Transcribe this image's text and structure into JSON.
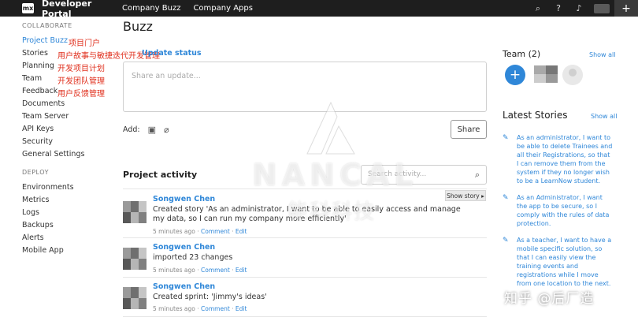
{
  "topbar": {
    "logo": "mx",
    "title": "Developer Portal",
    "nav": [
      "Company Buzz",
      "Company Apps"
    ],
    "icons": [
      "search-icon",
      "help-icon",
      "bell-icon",
      "plus-icon"
    ]
  },
  "sidebar": {
    "collaborate_heading": "COLLABORATE",
    "collaborate_items": [
      "Project Buzz",
      "Stories",
      "Planning",
      "Team",
      "Feedback",
      "Documents",
      "Team Server",
      "API Keys",
      "Security",
      "General Settings"
    ],
    "deploy_heading": "DEPLOY",
    "deploy_items": [
      "Environments",
      "Metrics",
      "Logs",
      "Backups",
      "Alerts",
      "Mobile App"
    ]
  },
  "annotations": [
    "项目门户",
    "用户故事与敏捷迭代开发管理",
    "开发项目计划",
    "开发团队管理",
    "用户反馈管理"
  ],
  "main": {
    "title": "Buzz",
    "update_link": "Update status",
    "update_placeholder": "Share an update...",
    "add_label": "Add:",
    "share_label": "Share",
    "activity_title": "Project activity",
    "search_placeholder": "Search activity...",
    "show_story": "Show story ▸",
    "activities": [
      {
        "name": "Songwen Chen",
        "text": "Created story 'As an administrator, I want to be able to easily access and manage my data, so I can run my company more efficiently'",
        "time": "5 minutes ago",
        "comment": "Comment",
        "edit": "Edit"
      },
      {
        "name": "Songwen Chen",
        "text": "imported 23 changes",
        "time": "5 minutes ago",
        "comment": "Comment",
        "edit": "Edit"
      },
      {
        "name": "Songwen Chen",
        "text": "Created sprint: 'Jimmy's ideas'",
        "time": "5 minutes ago",
        "comment": "Comment",
        "edit": "Edit"
      }
    ]
  },
  "right": {
    "team_title": "Team (2)",
    "show_all": "Show all",
    "stories_title": "Latest Stories",
    "stories": [
      "As an administrator, I want to be able to delete Trainees and all their Registrations, so that I can remove them from the system if they no longer wish to be a LearnNow student.",
      "As an Administrator, I want the app to be secure, so I comply with the rules of data protection.",
      "As a teacher, I want to have a mobile specific solution, so that I can easily view the training events and registrations while I move from one location to the next."
    ]
  },
  "watermark": {
    "brand": "NANCAL",
    "brand_cn": "能科科技",
    "zhihu": "知乎 @后厂造"
  }
}
